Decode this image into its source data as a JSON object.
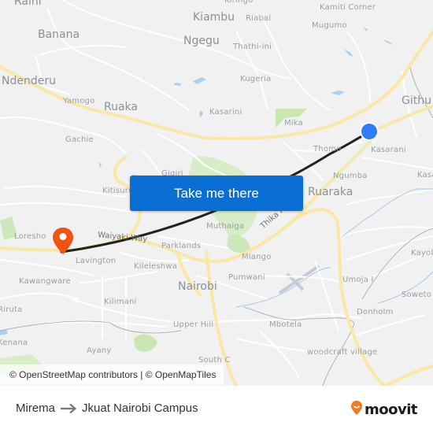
{
  "map": {
    "places": [
      {
        "name": "Raini",
        "size": "big"
      },
      {
        "name": "Banana",
        "size": "big"
      },
      {
        "name": "Ndenderu",
        "size": "big"
      },
      {
        "name": "Yamogo",
        "size": "sm"
      },
      {
        "name": "Ruaka",
        "size": "big"
      },
      {
        "name": "Gachie",
        "size": "sm"
      },
      {
        "name": "Kiambu",
        "size": "big"
      },
      {
        "name": "Ngegu",
        "size": "big"
      },
      {
        "name": "Kiringo",
        "size": "sm"
      },
      {
        "name": "Riabai",
        "size": "sm"
      },
      {
        "name": "Thathi-ini",
        "size": "sm"
      },
      {
        "name": "Kugeria",
        "size": "sm"
      },
      {
        "name": "Kasarini",
        "size": "sm"
      },
      {
        "name": "Mika",
        "size": "sm"
      },
      {
        "name": "Kamiti Corner",
        "size": "sm"
      },
      {
        "name": "Mugumo",
        "size": "sm"
      },
      {
        "name": "Githu",
        "size": "big"
      },
      {
        "name": "Thome",
        "size": "sm"
      },
      {
        "name": "Kasarani",
        "size": "sm"
      },
      {
        "name": "Ngumba",
        "size": "sm"
      },
      {
        "name": "Kasa",
        "size": "sm"
      },
      {
        "name": "Ruaraka",
        "size": "big"
      },
      {
        "name": "Kitisuru",
        "size": "sm"
      },
      {
        "name": "Gigiri",
        "size": "sm"
      },
      {
        "name": "Muthaiga",
        "size": "sm"
      },
      {
        "name": "Loresho",
        "size": "sm"
      },
      {
        "name": "Lavington",
        "size": "sm"
      },
      {
        "name": "Parklands",
        "size": "sm"
      },
      {
        "name": "Kileleshwa",
        "size": "sm"
      },
      {
        "name": "Mlango",
        "size": "sm"
      },
      {
        "name": "Kayole",
        "size": "sm"
      },
      {
        "name": "Kawangware",
        "size": "sm"
      },
      {
        "name": "Nairobi",
        "size": "big"
      },
      {
        "name": "Pumwani",
        "size": "sm"
      },
      {
        "name": "Umoja I",
        "size": "sm"
      },
      {
        "name": "Soweto",
        "size": "sm"
      },
      {
        "name": "Kilimani",
        "size": "sm"
      },
      {
        "name": "Riruta",
        "size": "sm"
      },
      {
        "name": "Donholm",
        "size": "sm"
      },
      {
        "name": "Upper Hill",
        "size": "sm"
      },
      {
        "name": "Mbotela",
        "size": "sm"
      },
      {
        "name": "Kenana",
        "size": "sm"
      },
      {
        "name": "Ayany",
        "size": "sm"
      },
      {
        "name": "woodcraft village",
        "size": "sm"
      },
      {
        "name": "South C",
        "size": "sm"
      }
    ],
    "roads": [
      {
        "name": "Waiyaki Way"
      },
      {
        "name": "Thika Road"
      }
    ],
    "origin_marker": {
      "icon": "origin-dot-icon",
      "color": "#2e7cf6"
    },
    "destination_marker": {
      "icon": "destination-pin-icon",
      "color": "#f2520f"
    },
    "route_color": "#222222"
  },
  "cta": {
    "label": "Take me there"
  },
  "attribution": {
    "text": "© OpenStreetMap contributors | © OpenMapTiles"
  },
  "footer": {
    "origin": "Mirema",
    "arrow_icon": "arrow-right-icon",
    "destination": "Jkuat Nairobi Campus",
    "brand": "moovit",
    "brand_icon": "moovit-pin-icon",
    "brand_color": "#f27a21"
  }
}
